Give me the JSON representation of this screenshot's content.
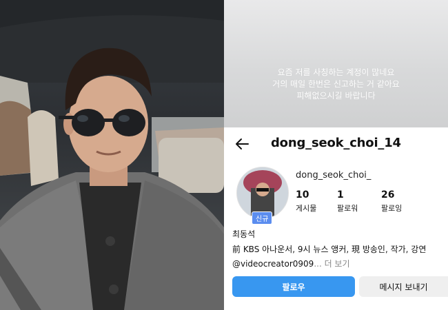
{
  "story": {
    "lines": [
      "요즘 저를 사칭하는 계정이 많네요",
      "거의 매일 한번은 신고하는 거 같아요",
      "피해없으시길 바랍니다"
    ]
  },
  "profile": {
    "handle": "dong_seok_choi_14",
    "username": "dong_seok_choi_",
    "new_badge": "신규",
    "stats": [
      {
        "value": "10",
        "label": "게시물"
      },
      {
        "value": "1",
        "label": "팔로워"
      },
      {
        "value": "26",
        "label": "팔로잉"
      }
    ],
    "real_name": "최동석",
    "bio": "前 KBS 아나운서, 9시 뉴스 앵커, 現 방송인, 작가, 강연",
    "link": "@videocreator0909",
    "more": "... 더 보기",
    "follow_label": "팔로우",
    "message_label": "메시지 보내기"
  },
  "colors": {
    "follow_button": "#3897f0",
    "new_badge": "#5b8def"
  },
  "icons": {
    "back": "arrow-left-icon"
  }
}
